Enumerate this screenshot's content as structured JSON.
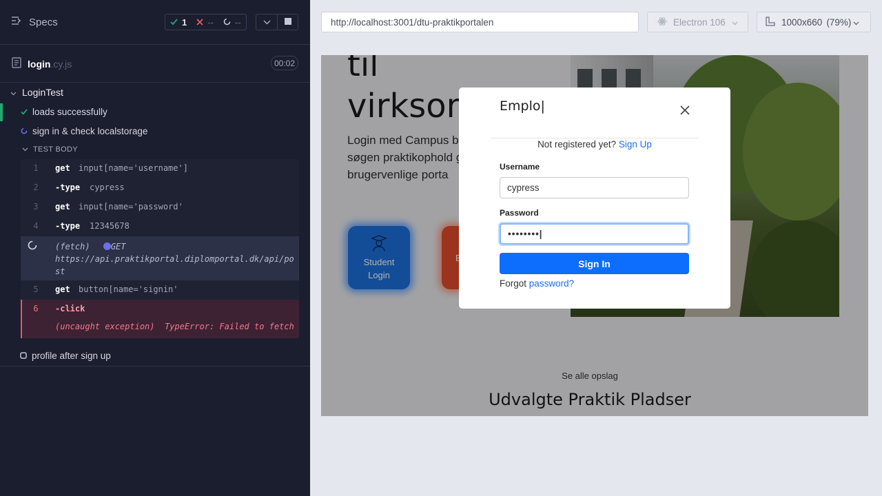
{
  "reporter": {
    "specs_label": "Specs",
    "stats": {
      "passed": "1",
      "failed": "--",
      "pending": "--"
    },
    "spec_file": {
      "name": "login",
      "ext": ".cy.js",
      "duration": "00:02"
    },
    "suite": {
      "title": "LoginTest",
      "tests": [
        {
          "title": "loads successfully",
          "state": "passed"
        },
        {
          "title": "sign in & check localstorage",
          "state": "running"
        },
        {
          "title": "profile after sign up",
          "state": "pending"
        }
      ],
      "body_label": "TEST BODY",
      "commands": [
        {
          "num": "1",
          "name": "get",
          "arg": "input[name='username']"
        },
        {
          "num": "2",
          "name": "-type",
          "arg": "cypress"
        },
        {
          "num": "3",
          "name": "get",
          "arg": "input[name='password'"
        },
        {
          "num": "4",
          "name": "-type",
          "arg": "12345678"
        },
        {
          "num": "5",
          "name": "get",
          "arg": "button[name='signin'"
        },
        {
          "num": "6",
          "name": "-click",
          "arg": ""
        }
      ],
      "fetch": {
        "tag": "(fetch)",
        "method": "GET",
        "url": "https://api.praktikportal.diplomportal.dk/api/post"
      },
      "error": {
        "label": "(uncaught exception)",
        "message": "TypeError: Failed to fetch"
      }
    }
  },
  "browser": {
    "url": "http://localhost:3001/dtu-praktikportalen",
    "browser_name": "Electron 106",
    "viewport": "1000x660",
    "zoom": "(79%)"
  },
  "app": {
    "hero_heading_line1": "til",
    "hero_heading_line2": "virksom",
    "hero_text": "Login med Campus begyndt din søgen praktikophold genn brugervenlige porta",
    "student_login": "Student Login",
    "business_initial": "B",
    "see_all": "Se alle opslag",
    "featured_title": "Udvalgte Praktik Pladser"
  },
  "modal": {
    "title": "Emplo|",
    "not_registered": "Not registered yet?",
    "sign_up": "Sign Up",
    "username_label": "Username",
    "username_value": "cypress",
    "password_label": "Password",
    "password_value": "••••••••|",
    "sign_in_label": "Sign In",
    "forgot_prefix": "Forgot",
    "forgot_link": "password?"
  },
  "colors": {
    "pass": "#1fa971",
    "fail": "#e45770",
    "accent": "#0d6efd",
    "reporter_bg": "#1b1e2e"
  }
}
